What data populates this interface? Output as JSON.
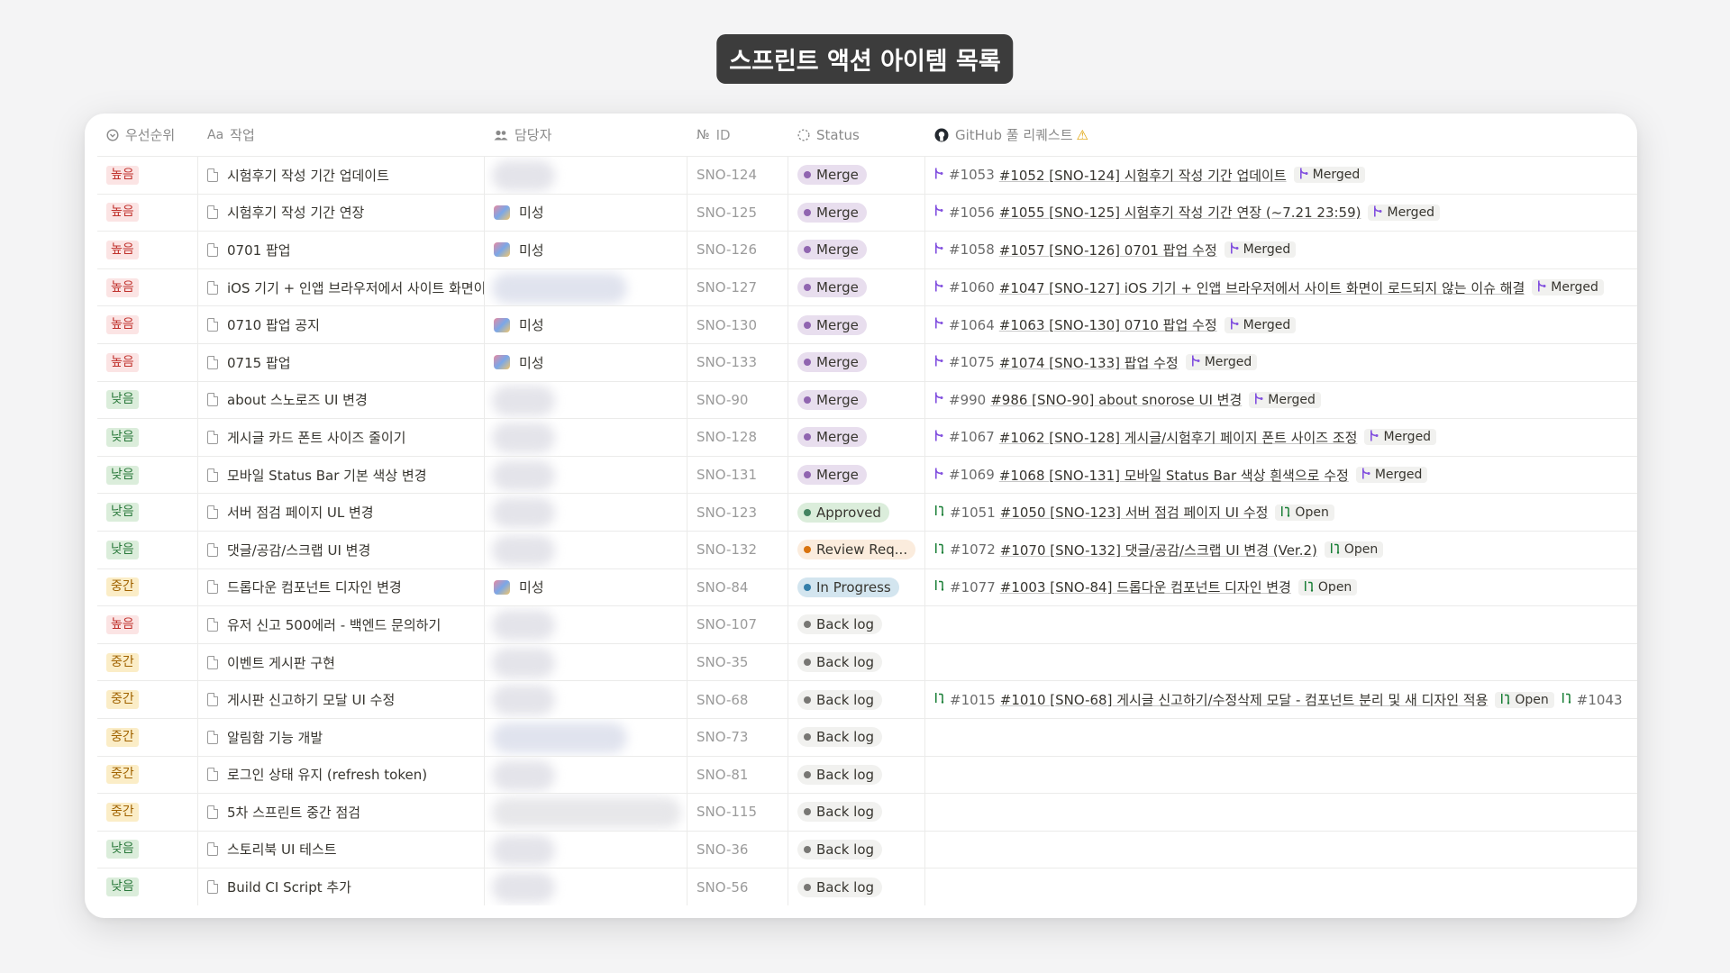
{
  "page_title": "스프린트 액션 아이템 목록",
  "columns": {
    "priority": "우선순위",
    "task": "작업",
    "owner": "담당자",
    "id": "ID",
    "id_icon": "№",
    "status": "Status",
    "pr": "GitHub 풀 리퀘스트",
    "pr_warning": "⚠"
  },
  "colors": {
    "merge": "#9065b0",
    "approved": "#448361",
    "review": "#d9730d",
    "in_progress": "#337ea9",
    "backlog": "#787774"
  },
  "rows": [
    {
      "priority": "높음",
      "pri": "high",
      "task": "시험후기 작성 기간 업데이트",
      "owner": "",
      "blur": 1,
      "id": "SNO-124",
      "status": "Merge",
      "st": "merge",
      "pr_icon": "merged",
      "pr_num": "#1053",
      "pr_title": "#1052 [SNO-124] 시험후기 작성 기간 업데이트",
      "pr_state": "Merged",
      "pr_extra": ""
    },
    {
      "priority": "높음",
      "pri": "high",
      "task": "시험후기 작성 기간 연장",
      "owner": "미성",
      "blur": 0,
      "id": "SNO-125",
      "status": "Merge",
      "st": "merge",
      "pr_icon": "merged",
      "pr_num": "#1056",
      "pr_title": "#1055 [SNO-125] 시험후기 작성 기간 연장 (~7.21 23:59)",
      "pr_state": "Merged",
      "pr_extra": ""
    },
    {
      "priority": "높음",
      "pri": "high",
      "task": "0701 팝업",
      "owner": "미성",
      "blur": 0,
      "id": "SNO-126",
      "status": "Merge",
      "st": "merge",
      "pr_icon": "merged",
      "pr_num": "#1058",
      "pr_title": "#1057 [SNO-126] 0701 팝업 수정",
      "pr_state": "Merged",
      "pr_extra": ""
    },
    {
      "priority": "높음",
      "pri": "high",
      "task": "iOS 기기 + 인앱 브라우저에서 사이트 화면이",
      "owner": "",
      "blur": 2,
      "id": "SNO-127",
      "status": "Merge",
      "st": "merge",
      "pr_icon": "merged",
      "pr_num": "#1060",
      "pr_title": "#1047 [SNO-127] iOS 기기 + 인앱 브라우저에서 사이트 화면이 로드되지 않는 이슈 해결",
      "pr_state": "Merged",
      "pr_extra": ""
    },
    {
      "priority": "높음",
      "pri": "high",
      "task": "0710 팝업 공지",
      "owner": "미성",
      "blur": 0,
      "id": "SNO-130",
      "status": "Merge",
      "st": "merge",
      "pr_icon": "merged",
      "pr_num": "#1064",
      "pr_title": "#1063 [SNO-130] 0710 팝업 수정",
      "pr_state": "Merged",
      "pr_extra": ""
    },
    {
      "priority": "높음",
      "pri": "high",
      "task": "0715 팝업",
      "owner": "미성",
      "blur": 0,
      "id": "SNO-133",
      "status": "Merge",
      "st": "merge",
      "pr_icon": "merged",
      "pr_num": "#1075",
      "pr_title": "#1074 [SNO-133] 팝업 수정",
      "pr_state": "Merged",
      "pr_extra": ""
    },
    {
      "priority": "낮음",
      "pri": "low",
      "task": "about 스노로즈 UI 변경",
      "owner": "",
      "blur": 1,
      "id": "SNO-90",
      "status": "Merge",
      "st": "merge",
      "pr_icon": "merged",
      "pr_num": "#990",
      "pr_title": "#986 [SNO-90] about snorose UI 변경",
      "pr_state": "Merged",
      "pr_extra": ""
    },
    {
      "priority": "낮음",
      "pri": "low",
      "task": "게시글 카드 폰트 사이즈 줄이기",
      "owner": "",
      "blur": 1,
      "id": "SNO-128",
      "status": "Merge",
      "st": "merge",
      "pr_icon": "merged",
      "pr_num": "#1067",
      "pr_title": "#1062 [SNO-128] 게시글/시험후기 페이지 폰트 사이즈 조정",
      "pr_state": "Merged",
      "pr_extra": ""
    },
    {
      "priority": "낮음",
      "pri": "low",
      "task": "모바일 Status Bar 기본 색상 변경",
      "owner": "",
      "blur": 1,
      "id": "SNO-131",
      "status": "Merge",
      "st": "merge",
      "pr_icon": "merged",
      "pr_num": "#1069",
      "pr_title": "#1068 [SNO-131] 모바일 Status Bar 색상 흰색으로 수정",
      "pr_state": "Merged",
      "pr_extra": ""
    },
    {
      "priority": "낮음",
      "pri": "low",
      "task": "서버 점검 페이지 UL 변경",
      "owner": "",
      "blur": 1,
      "id": "SNO-123",
      "status": "Approved",
      "st": "approved",
      "pr_icon": "open",
      "pr_num": "#1051",
      "pr_title": "#1050 [SNO-123] 서버 점검 페이지 UI 수정",
      "pr_state": "Open",
      "pr_extra": ""
    },
    {
      "priority": "낮음",
      "pri": "low",
      "task": "댓글/공감/스크랩 UI 변경",
      "owner": "",
      "blur": 1,
      "id": "SNO-132",
      "status": "Review Req...",
      "st": "review",
      "pr_icon": "open",
      "pr_num": "#1072",
      "pr_title": "#1070 [SNO-132] 댓글/공감/스크랩 UI 변경 (Ver.2)",
      "pr_state": "Open",
      "pr_extra": ""
    },
    {
      "priority": "중간",
      "pri": "mid",
      "task": "드롭다운 컴포넌트 디자인 변경",
      "owner": "미성",
      "blur": 0,
      "id": "SNO-84",
      "status": "In Progress",
      "st": "progress",
      "pr_icon": "open",
      "pr_num": "#1077",
      "pr_title": "#1003 [SNO-84] 드롭다운 컴포넌트 디자인 변경",
      "pr_state": "Open",
      "pr_extra": ""
    },
    {
      "priority": "높음",
      "pri": "high",
      "task": "유저 신고 500에러 - 백엔드 문의하기",
      "owner": "",
      "blur": 1,
      "id": "SNO-107",
      "status": "Back log",
      "st": "backlog",
      "pr_icon": "",
      "pr_num": "",
      "pr_title": "",
      "pr_state": "",
      "pr_extra": ""
    },
    {
      "priority": "중간",
      "pri": "mid",
      "task": "이벤트 게시판 구현",
      "owner": "",
      "blur": 1,
      "id": "SNO-35",
      "status": "Back log",
      "st": "backlog",
      "pr_icon": "",
      "pr_num": "",
      "pr_title": "",
      "pr_state": "",
      "pr_extra": ""
    },
    {
      "priority": "중간",
      "pri": "mid",
      "task": "게시판 신고하기 모달 UI 수정",
      "owner": "",
      "blur": 1,
      "id": "SNO-68",
      "status": "Back log",
      "st": "backlog",
      "pr_icon": "open",
      "pr_num": "#1015",
      "pr_title": "#1010 [SNO-68] 게시글 신고하기/수정삭제 모달 - 컴포넌트 분리 및 새 디자인 적용",
      "pr_state": "Open",
      "pr_extra": "#1043"
    },
    {
      "priority": "중간",
      "pri": "mid",
      "task": "알림함 기능 개발",
      "owner": "",
      "blur": 2,
      "id": "SNO-73",
      "status": "Back log",
      "st": "backlog",
      "pr_icon": "",
      "pr_num": "",
      "pr_title": "",
      "pr_state": "",
      "pr_extra": ""
    },
    {
      "priority": "중간",
      "pri": "mid",
      "task": "로그인 상태 유지 (refresh token)",
      "owner": "",
      "blur": 1,
      "id": "SNO-81",
      "status": "Back log",
      "st": "backlog",
      "pr_icon": "",
      "pr_num": "",
      "pr_title": "",
      "pr_state": "",
      "pr_extra": ""
    },
    {
      "priority": "중간",
      "pri": "mid",
      "task": "5차 스프린트 중간 점검",
      "owner": "",
      "blur": 3,
      "id": "SNO-115",
      "status": "Back log",
      "st": "backlog",
      "pr_icon": "",
      "pr_num": "",
      "pr_title": "",
      "pr_state": "",
      "pr_extra": ""
    },
    {
      "priority": "낮음",
      "pri": "low",
      "task": "스토리북 UI 테스트",
      "owner": "",
      "blur": 1,
      "id": "SNO-36",
      "status": "Back log",
      "st": "backlog",
      "pr_icon": "",
      "pr_num": "",
      "pr_title": "",
      "pr_state": "",
      "pr_extra": ""
    },
    {
      "priority": "낮음",
      "pri": "low",
      "task": "Build CI Script 추가",
      "owner": "",
      "blur": 1,
      "id": "SNO-56",
      "status": "Back log",
      "st": "backlog",
      "pr_icon": "",
      "pr_num": "",
      "pr_title": "",
      "pr_state": "",
      "pr_extra": ""
    }
  ]
}
